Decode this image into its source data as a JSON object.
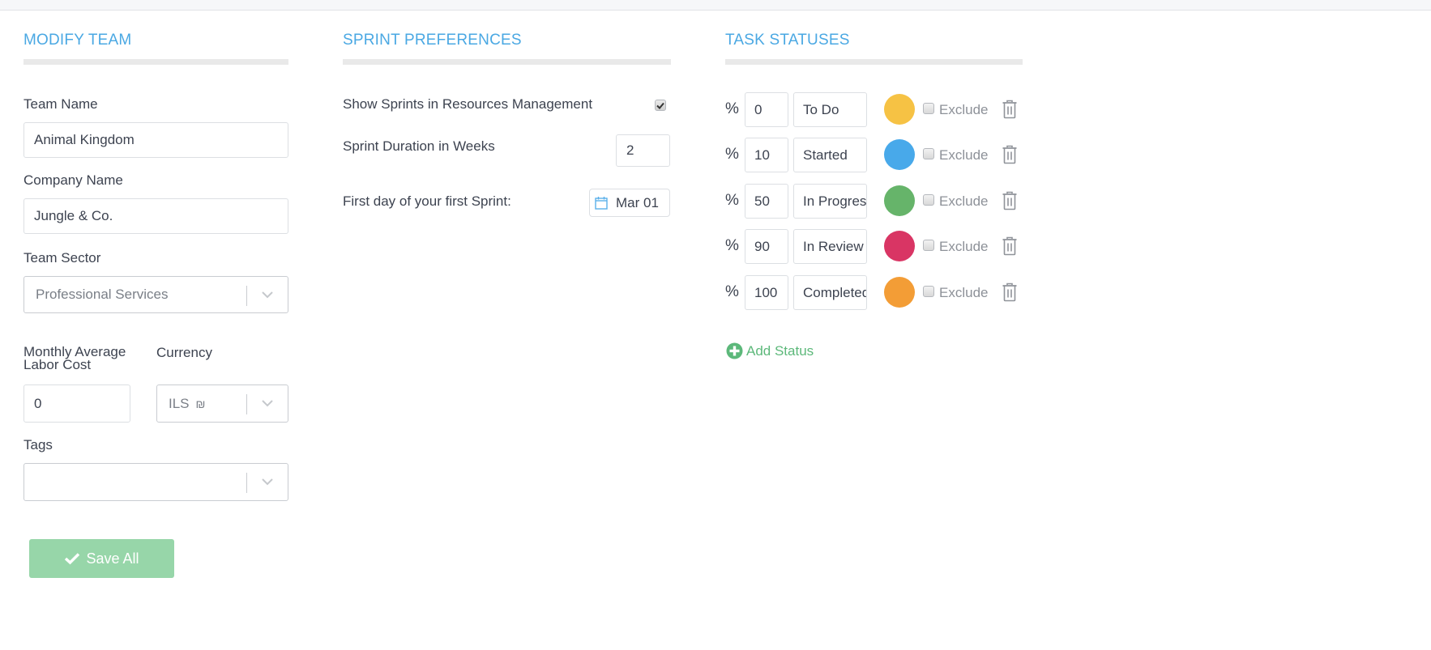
{
  "modify_team": {
    "title": "MODIFY TEAM",
    "team_name_label": "Team Name",
    "team_name_value": "Animal Kingdom",
    "company_name_label": "Company Name",
    "company_name_value": "Jungle & Co.",
    "team_sector_label": "Team Sector",
    "team_sector_value": "Professional Services",
    "labor_cost_label_line1": "Monthly Average",
    "labor_cost_label_line2": "Labor Cost",
    "labor_cost_value": "0",
    "currency_label": "Currency",
    "currency_value": "ILS",
    "currency_symbol": "₪",
    "tags_label": "Tags",
    "tags_value": "",
    "save_label": "Save All"
  },
  "sprint_preferences": {
    "title": "SPRINT PREFERENCES",
    "show_sprints_label": "Show Sprints in Resources Management",
    "show_sprints_checked": true,
    "duration_label": "Sprint Duration in Weeks",
    "duration_value": "2",
    "first_day_label": "First day of your first Sprint:",
    "first_day_value": "Mar 01"
  },
  "task_statuses": {
    "title": "TASK STATUSES",
    "pct_symbol": "%",
    "exclude_label": "Exclude",
    "add_label": "Add Status",
    "items": [
      {
        "percent": "0",
        "name": "To Do",
        "color": "#f6c244",
        "excluded": false
      },
      {
        "percent": "10",
        "name": "Started",
        "color": "#48a9ea",
        "excluded": false
      },
      {
        "percent": "50",
        "name": "In Progress",
        "color": "#66b46a",
        "excluded": false
      },
      {
        "percent": "90",
        "name": "In Review",
        "color": "#d93564",
        "excluded": false
      },
      {
        "percent": "100",
        "name": "Completed",
        "color": "#f39d36",
        "excluded": false
      }
    ]
  },
  "colors": {
    "accent": "#4aa8e3",
    "success": "#97d6a9",
    "add_green": "#5cb87a"
  }
}
